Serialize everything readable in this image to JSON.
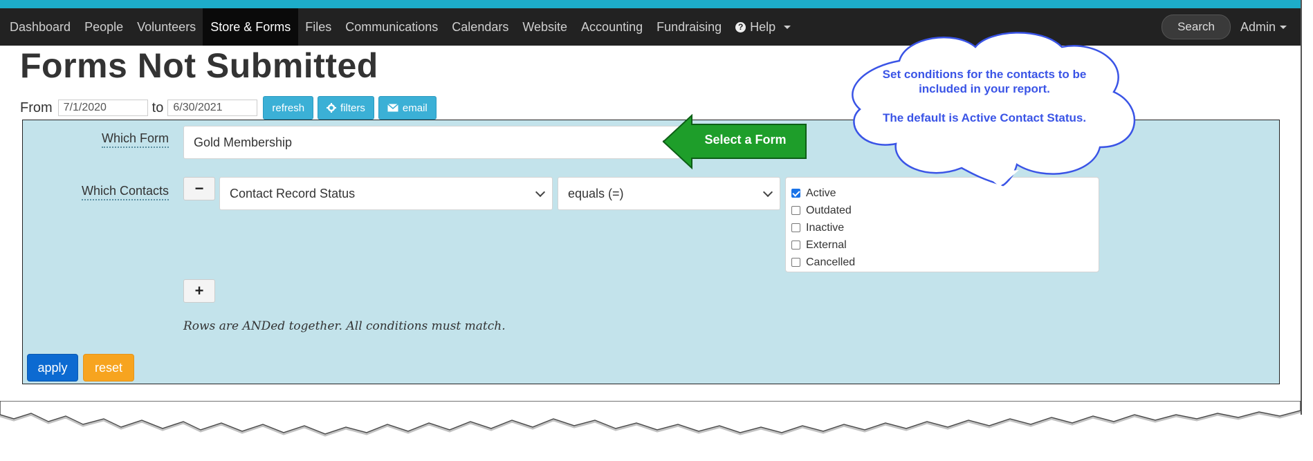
{
  "nav": {
    "items": [
      "Dashboard",
      "People",
      "Volunteers",
      "Store & Forms",
      "Files",
      "Communications",
      "Calendars",
      "Website",
      "Accounting",
      "Fundraising"
    ],
    "active": "Store & Forms",
    "help": "Help",
    "search": "Search",
    "admin": "Admin"
  },
  "page": {
    "title": "Forms Not Submitted"
  },
  "dates": {
    "from_label": "From",
    "from_value": "7/1/2020",
    "to_label": "to",
    "to_value": "6/30/2021"
  },
  "actions": {
    "refresh": "refresh",
    "filters": "filters",
    "email": "email"
  },
  "filter": {
    "which_form_label": "Which Form",
    "form_value": "Gold Membership",
    "which_contacts_label": "Which Contacts",
    "remove_label": "−",
    "add_label": "+",
    "field_value": "Contact Record Status",
    "operator_value": "equals (=)",
    "statuses": [
      {
        "label": "Active",
        "checked": true
      },
      {
        "label": "Outdated",
        "checked": false
      },
      {
        "label": "Inactive",
        "checked": false
      },
      {
        "label": "External",
        "checked": false
      },
      {
        "label": "Cancelled",
        "checked": false
      }
    ],
    "note": "Rows are ANDed together. All conditions must match.",
    "apply": "apply",
    "reset": "reset"
  },
  "annotations": {
    "select_form": "Select a Form",
    "cloud_line1": "Set conditions for the contacts to be included in your report.",
    "cloud_line2": "The default is Active Contact Status."
  },
  "colors": {
    "nav_bg": "#222222",
    "panel_bg": "#c3e3eb",
    "apply": "#0c6ad1",
    "reset": "#f7a41f",
    "callout_green": "#1e9e2a",
    "cloud_text": "#3a54e6"
  }
}
